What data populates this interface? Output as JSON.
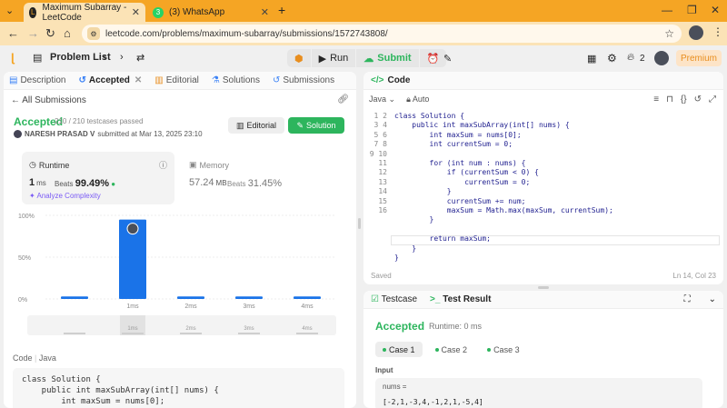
{
  "browser": {
    "tabs": [
      {
        "title": "Maximum Subarray - LeetCode",
        "active": true
      },
      {
        "title": "(3) WhatsApp",
        "badge": "3",
        "active": false
      }
    ],
    "url": "leetcode.com/problems/maximum-subarray/submissions/1572743808/"
  },
  "nav": {
    "problem_list": "Problem List",
    "run": "Run",
    "submit": "Submit",
    "streak": "2",
    "premium": "Premium"
  },
  "left_tabs": [
    "Description",
    "Accepted",
    "Editorial",
    "Solutions",
    "Submissions"
  ],
  "submission": {
    "back": "All Submissions",
    "status": "Accepted",
    "testcases": "210 / 210 testcases passed",
    "author": "NARESH PRASAD V",
    "submitted": "submitted at Mar 13, 2025 23:10",
    "editorial_btn": "Editorial",
    "solution_btn": "Solution"
  },
  "runtime": {
    "title": "Runtime",
    "value": "1",
    "unit": "ms",
    "beats_label": "Beats",
    "beats": "99.49%",
    "analyze": "Analyze Complexity"
  },
  "memory": {
    "title": "Memory",
    "value": "57.24",
    "unit": "MB",
    "beats_label": "Beats",
    "beats": "31.45%"
  },
  "chart_data": {
    "type": "bar",
    "categories": [
      "",
      "1ms",
      "2ms",
      "3ms",
      "4ms"
    ],
    "values": [
      3,
      95,
      3,
      3,
      3
    ],
    "yticks": [
      "100%",
      "50%",
      "0%"
    ],
    "ylim": [
      0,
      100
    ],
    "highlight_index": 1,
    "bar_color": "#1a73e8",
    "minimap_labels": [
      "1ms",
      "2ms",
      "3ms",
      "4ms"
    ]
  },
  "code_section": {
    "label": "Code",
    "lang": "Java",
    "preview": "class Solution {\n    public int maxSubArray(int[] nums) {\n        int maxSum = nums[0];"
  },
  "editor": {
    "title": "Code",
    "lang": "Java",
    "mode": "Auto",
    "line_numbers": "1\n2\n3\n4\n5\n6\n7\n8\n9\n10\n11\n12\n13\n14\n15\n16",
    "code": "class Solution {\n    public int maxSubArray(int[] nums) {\n        int maxSum = nums[0];\n        int currentSum = 0;\n\n        for (int num : nums) {\n            if (currentSum < 0) {\n                currentSum = 0;\n            }\n            currentSum += num;\n            maxSum = Math.max(maxSum, currentSum);\n        }\n\n        return maxSum;\n    }\n}",
    "saved": "Saved",
    "cursor": "Ln 14, Col 23"
  },
  "result": {
    "testcase_tab": "Testcase",
    "result_tab": "Test Result",
    "status": "Accepted",
    "runtime": "Runtime: 0 ms",
    "cases": [
      "Case 1",
      "Case 2",
      "Case 3"
    ],
    "input_label": "Input",
    "param": "nums =",
    "value": "[-2,1,-3,4,-1,2,1,-5,4]"
  }
}
